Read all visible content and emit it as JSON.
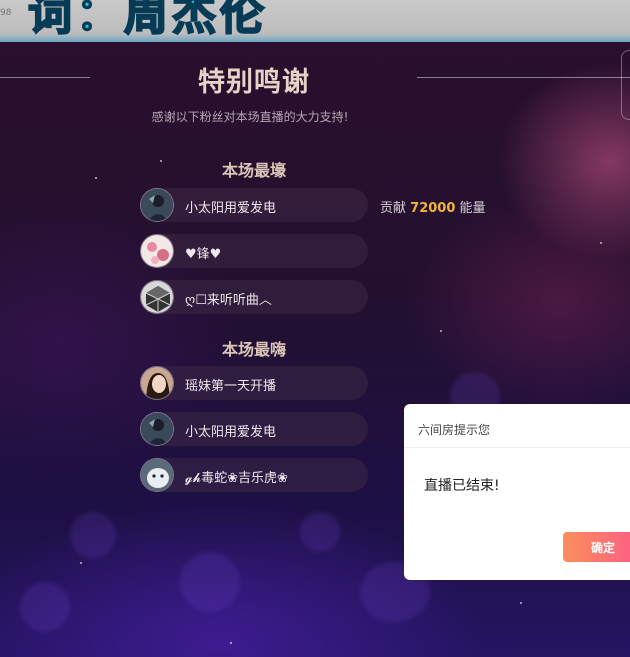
{
  "banner": {
    "corner_text": "98",
    "lyric_text": "词：周杰伦"
  },
  "thanks": {
    "title": "特别鸣谢",
    "subtitle": "感谢以下粉丝对本场直播的大力支持!"
  },
  "top_contributors": {
    "section_title": "本场最壕",
    "fans": [
      {
        "name": "小太阳用爱发电",
        "avatar": "avatar-dark-figure"
      },
      {
        "name": "♥锋♥",
        "avatar": "avatar-pink-flowers"
      },
      {
        "name": "ღ☐来听听曲︿",
        "avatar": "avatar-cube"
      }
    ],
    "contribution": {
      "prefix": "贡献",
      "amount": "72000",
      "unit": "能量"
    }
  },
  "most_active": {
    "section_title": "本场最嗨",
    "fans": [
      {
        "name": "瑶妹第一天开播",
        "avatar": "avatar-girl-portrait"
      },
      {
        "name": "小太阳用爱发电",
        "avatar": "avatar-dark-figure"
      },
      {
        "name": "𝓰𝓱毒蛇❀吉乐虎❀",
        "avatar": "avatar-white-animal"
      }
    ]
  },
  "dialog": {
    "title": "六间房提示您",
    "message": "直播已结束!",
    "ok_label": "确定"
  },
  "colors": {
    "accent_gold": "#f0b43a",
    "button_start": "#fb8f5c",
    "button_end": "#fb5a86",
    "lyric_cyan": "#16c8e6"
  }
}
